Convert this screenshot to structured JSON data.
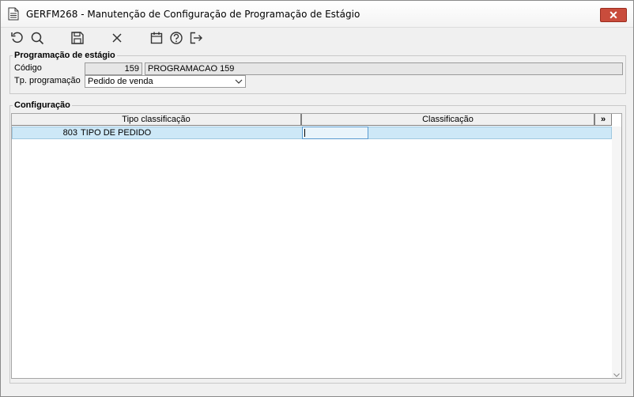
{
  "window": {
    "title": "GERFM268 - Manutenção de Configuração de Programação de Estágio",
    "close_label": "✕"
  },
  "toolbar": {
    "buttons": [
      {
        "name": "refresh-icon"
      },
      {
        "name": "search-icon"
      },
      {
        "name": "save-icon"
      },
      {
        "name": "close-icon"
      },
      {
        "name": "calendar-icon"
      },
      {
        "name": "help-icon"
      },
      {
        "name": "exit-icon"
      }
    ]
  },
  "programacao": {
    "group_title": "Programação de estágio",
    "codigo_label": "Código",
    "codigo_value": "159",
    "descricao_value": "PROGRAMACAO 159",
    "tipo_label": "Tp. programação",
    "tipo_value": "Pedido de venda"
  },
  "configuracao": {
    "group_title": "Configuração",
    "columns": [
      "Tipo classificação",
      "Classificação",
      "»"
    ],
    "rows": [
      {
        "code": "803",
        "tipo": "TIPO DE PEDIDO",
        "classificacao": ""
      }
    ]
  }
}
